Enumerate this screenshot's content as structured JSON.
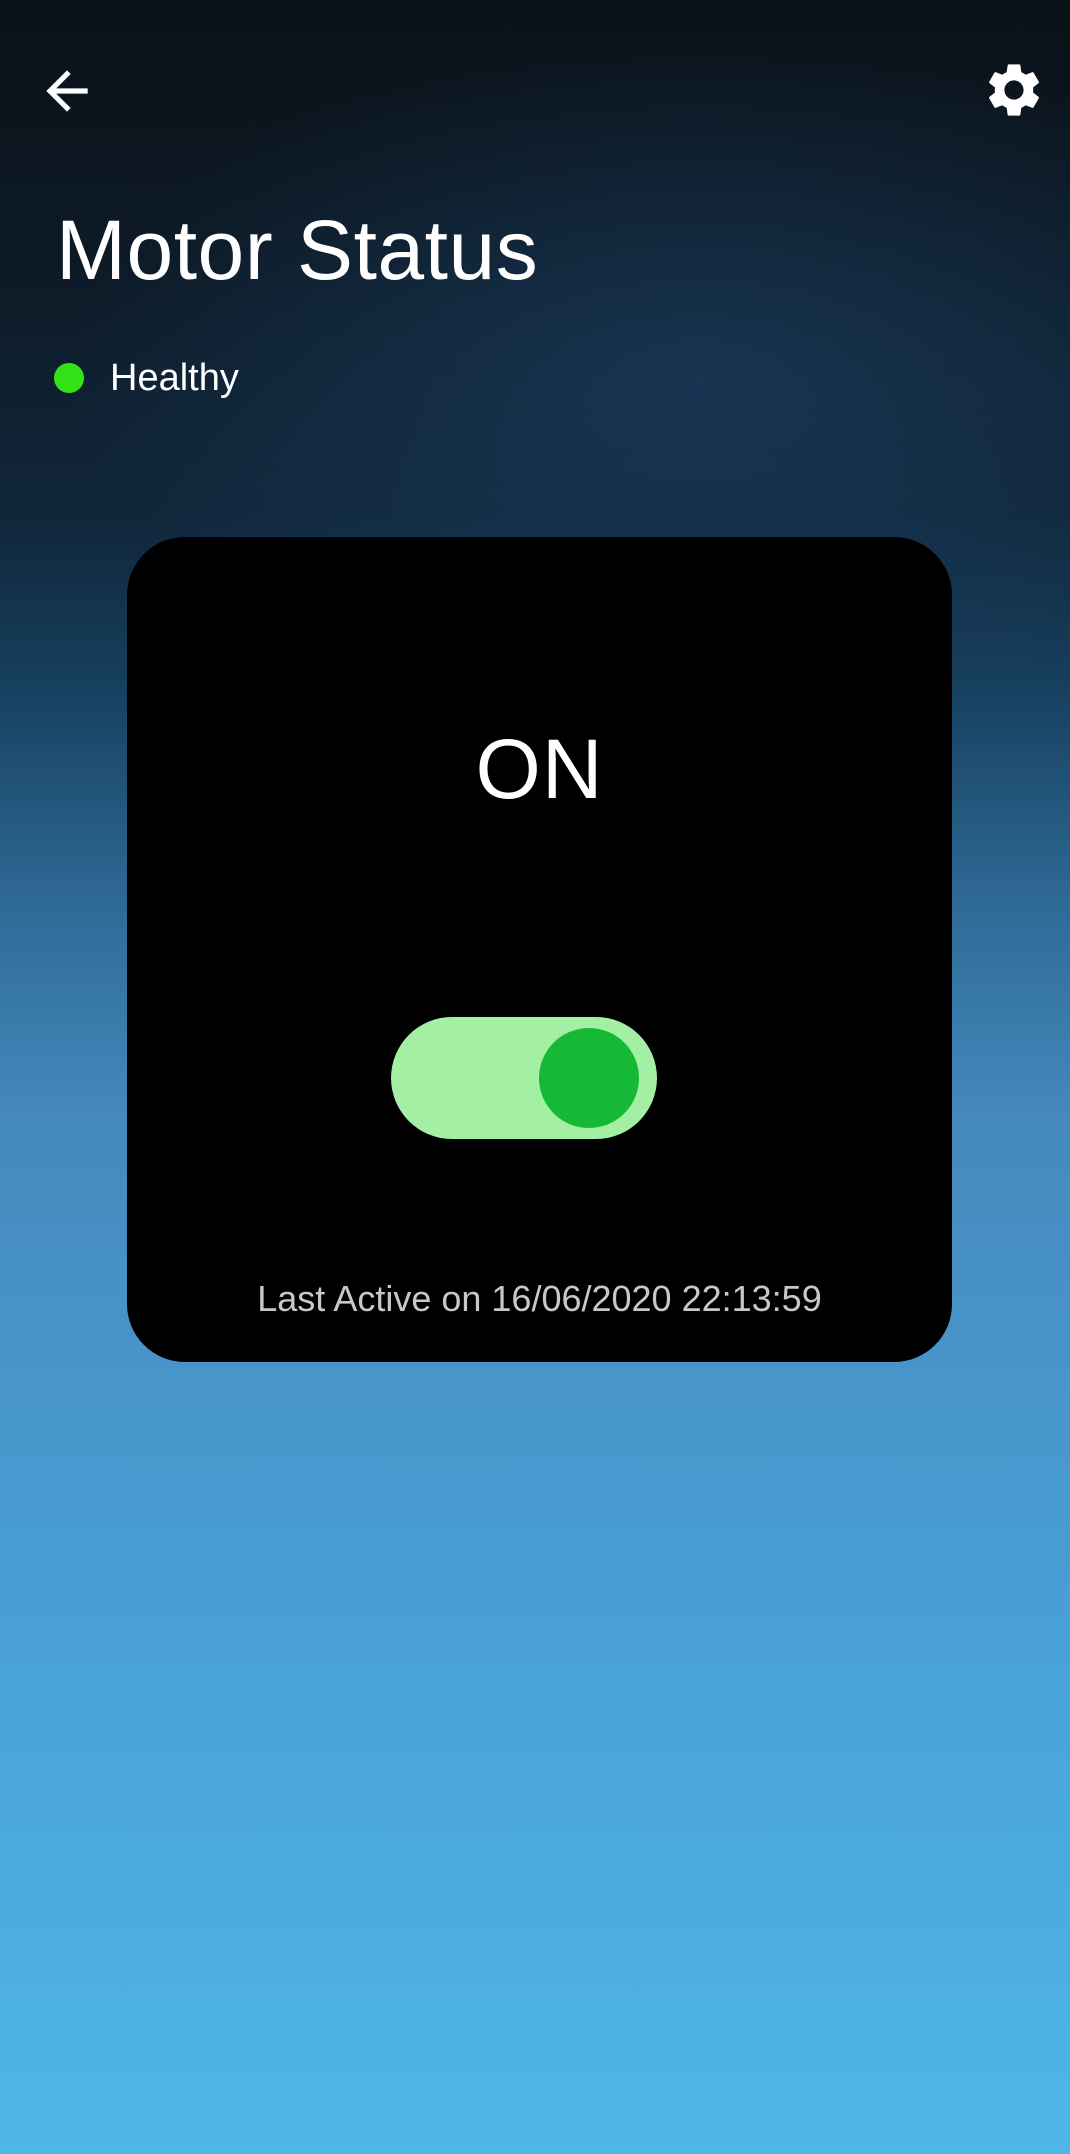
{
  "header": {
    "back_icon": "arrow-left-icon",
    "settings_icon": "gear-icon"
  },
  "page": {
    "title": "Motor Status"
  },
  "status": {
    "label": "Healthy",
    "color": "#33e318"
  },
  "motor_card": {
    "state_label": "ON",
    "toggle_on": true,
    "toggle_track_color": "#a3f0a4",
    "toggle_knob_color": "#15b936",
    "last_active": "Last Active on 16/06/2020 22:13:59"
  }
}
